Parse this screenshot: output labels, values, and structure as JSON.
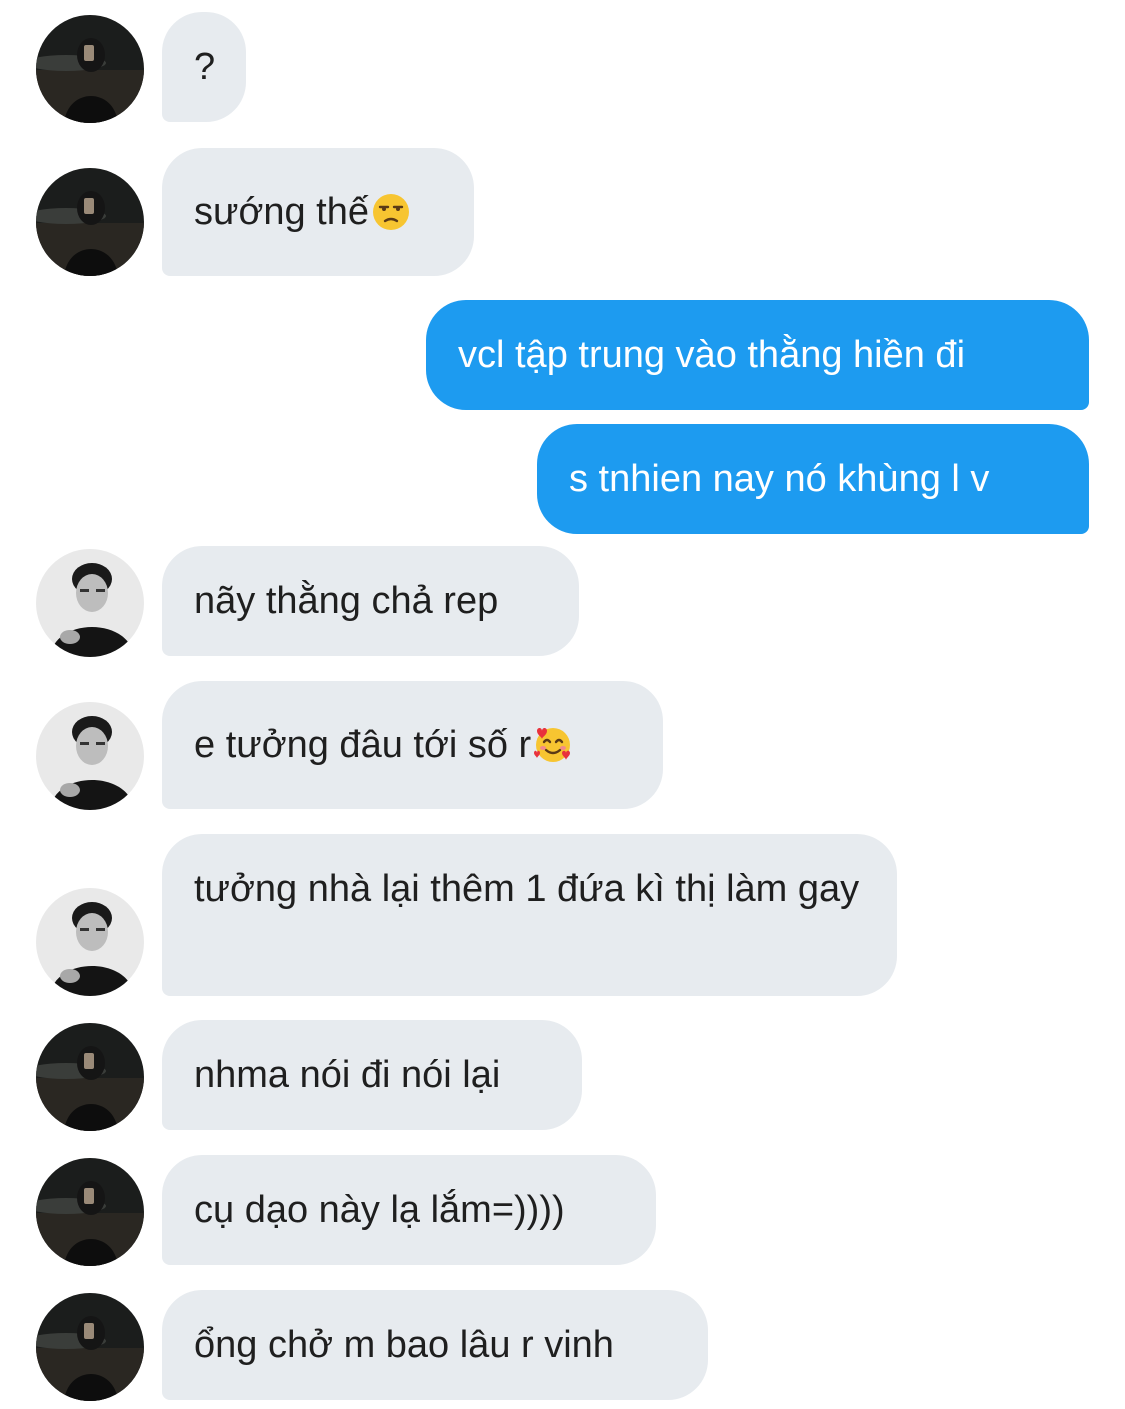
{
  "messages": [
    {
      "id": "m1",
      "side": "in",
      "avatar": "avatar-a",
      "text": "?"
    },
    {
      "id": "m2",
      "side": "in",
      "avatar": "avatar-a",
      "text": "sướng thế",
      "emoji": "unamused-face-icon"
    },
    {
      "id": "m3",
      "side": "out",
      "text": "vcl tập trung vào thằng hiền đi"
    },
    {
      "id": "m4",
      "side": "out",
      "text": "s tnhien nay nó khùng l v"
    },
    {
      "id": "m5",
      "side": "in",
      "avatar": "avatar-b",
      "text": "nãy thằng chả rep"
    },
    {
      "id": "m6",
      "side": "in",
      "avatar": "avatar-b",
      "text": "e tưởng đâu tới số r",
      "emoji": "smiling-face-with-hearts-icon"
    },
    {
      "id": "m7",
      "side": "in",
      "avatar": "avatar-b",
      "text": "tưởng nhà lại thêm 1 đứa kì thị làm gay"
    },
    {
      "id": "m8",
      "side": "in",
      "avatar": "avatar-a",
      "text": "nhma nói đi nói lại"
    },
    {
      "id": "m9",
      "side": "in",
      "avatar": "avatar-a",
      "text": "cụ dạo này lạ lắm=))))"
    },
    {
      "id": "m10",
      "side": "in",
      "avatar": "avatar-a",
      "text": "ổng chở m bao lâu r vinh"
    }
  ],
  "colors": {
    "incoming_bubble": "#e7ebef",
    "outgoing_bubble": "#1d9bf0",
    "incoming_text": "#1f1f1f",
    "outgoing_text": "#ffffff"
  }
}
